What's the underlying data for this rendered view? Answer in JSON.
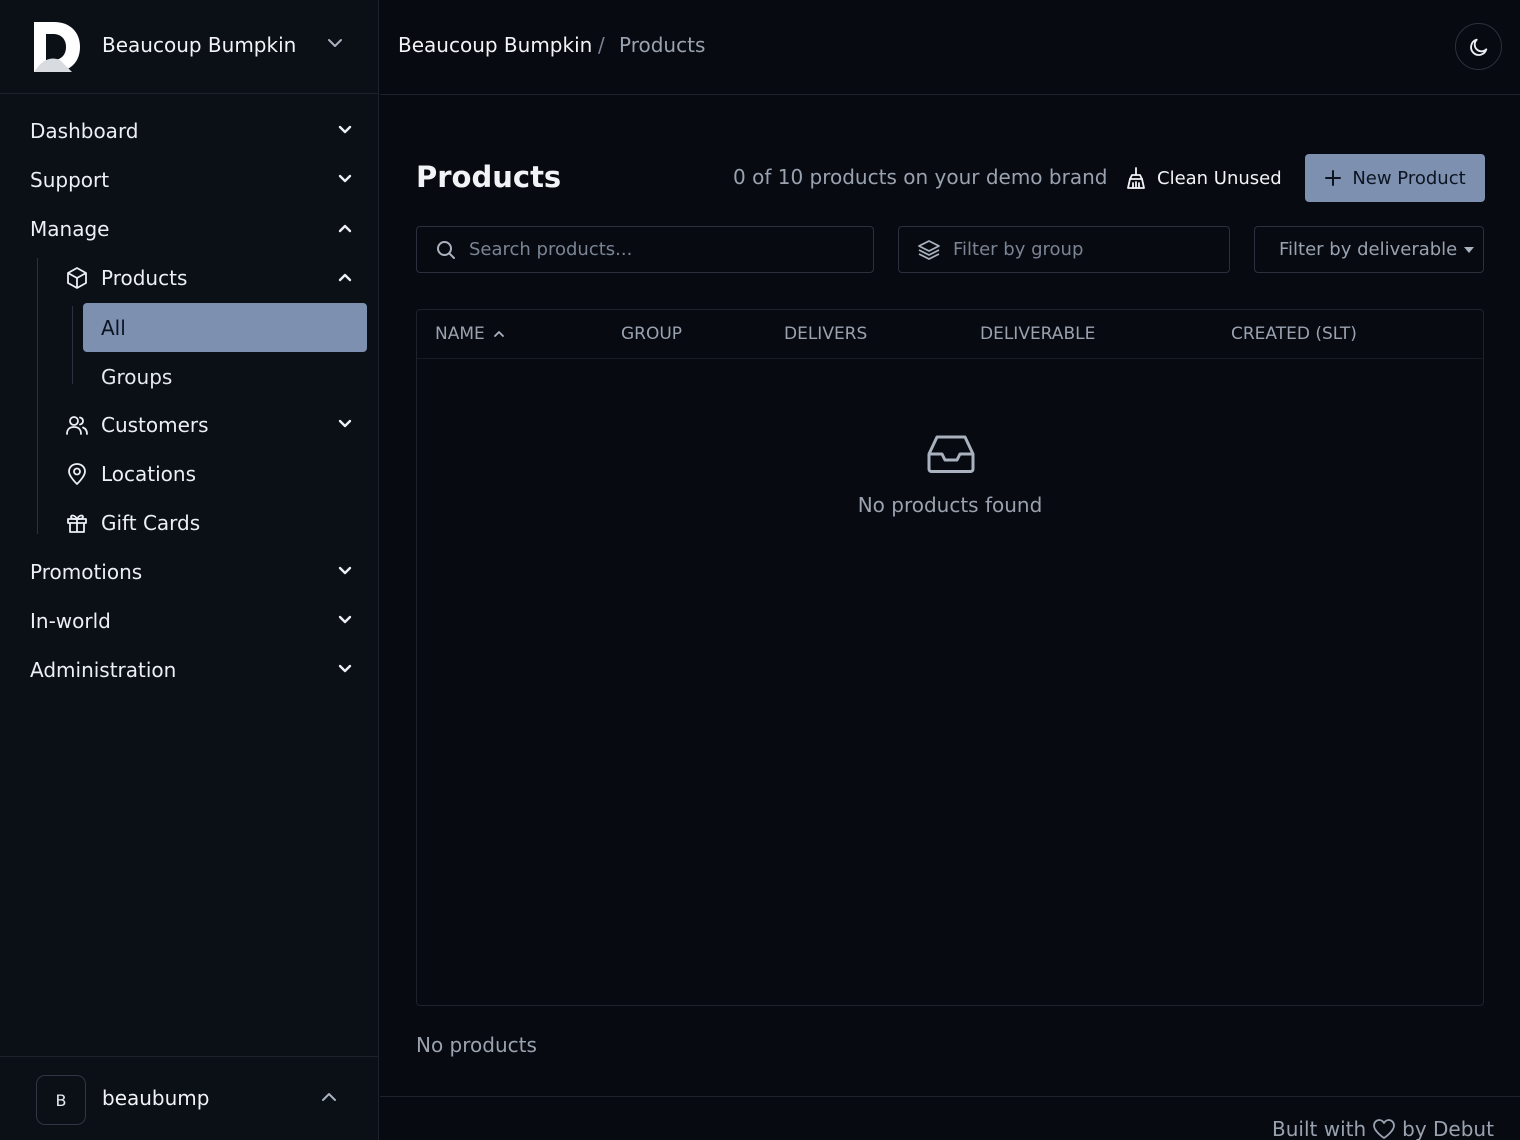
{
  "brand": {
    "name": "Beaucoup Bumpkin",
    "logo_icon": "brand-logo-icon"
  },
  "breadcrumb": {
    "items": [
      "Beaucoup Bumpkin",
      "Products"
    ],
    "separator": "/"
  },
  "theme_toggle": {
    "icon": "moon-icon"
  },
  "sidebar": {
    "top_items": [
      {
        "label": "Dashboard",
        "expanded": false
      },
      {
        "label": "Support",
        "expanded": false
      },
      {
        "label": "Manage",
        "expanded": true
      },
      {
        "label": "Promotions",
        "expanded": false
      },
      {
        "label": "In-world",
        "expanded": false
      },
      {
        "label": "Administration",
        "expanded": false
      }
    ],
    "manage_items": [
      {
        "label": "Products",
        "icon": "cube-icon",
        "expanded": true
      },
      {
        "label": "Customers",
        "icon": "users-icon",
        "expanded": false
      },
      {
        "label": "Locations",
        "icon": "map-pin-icon"
      },
      {
        "label": "Gift Cards",
        "icon": "gift-icon"
      }
    ],
    "products_sub": [
      {
        "label": "All",
        "active": true
      },
      {
        "label": "Groups",
        "active": false
      }
    ]
  },
  "user": {
    "avatar_initial": "B",
    "username": "beaubump"
  },
  "main": {
    "title": "Products",
    "count_text": "0 of 10 products on your demo brand",
    "clean_label": "Clean Unused",
    "new_label": "New Product",
    "search_placeholder": "Search products...",
    "group_filter_placeholder": "Filter by group",
    "deliverable_filter_label": "Filter by deliverable",
    "columns": [
      "NAME",
      "GROUP",
      "DELIVERS",
      "DELIVERABLE",
      "CREATED (SLT)"
    ],
    "sorted_column": "NAME",
    "empty_text": "No products found",
    "footer_count": "No products"
  },
  "footer": {
    "prefix": "Built with",
    "suffix": "by Debut"
  },
  "colors": {
    "background": "#070a10",
    "sidebar": "#0b0f16",
    "accent": "#7d90b0",
    "border": "#1d232d"
  }
}
